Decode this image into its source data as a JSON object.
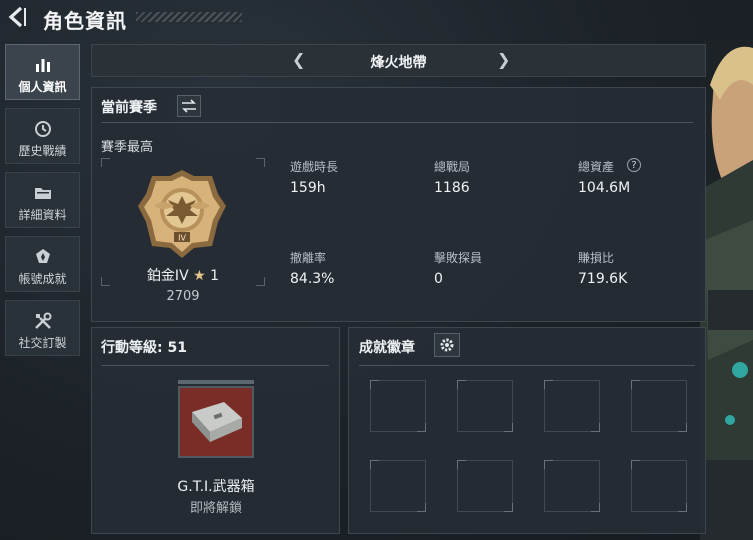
{
  "header": {
    "title": "角色資訊"
  },
  "sidebar": {
    "items": [
      {
        "label": "個人資訊",
        "icon": "bar-chart-icon",
        "active": true
      },
      {
        "label": "歷史戰績",
        "icon": "history-clock-icon",
        "active": false
      },
      {
        "label": "詳細資料",
        "icon": "folder-icon",
        "active": false
      },
      {
        "label": "帳號成就",
        "icon": "medal-icon",
        "active": false
      },
      {
        "label": "社交訂製",
        "icon": "tools-icon",
        "active": false
      }
    ]
  },
  "tabbar": {
    "title": "烽火地帶"
  },
  "season": {
    "title": "當前賽季",
    "subtitle": "賽季最高",
    "rank_name": "鉑金IV",
    "rank_stars": "1",
    "rank_score": "2709",
    "stats": [
      {
        "label": "遊戲時長",
        "value": "159h"
      },
      {
        "label": "總戰局",
        "value": "1186"
      },
      {
        "label": "總資產",
        "value": "104.6M"
      },
      {
        "label": "撤離率",
        "value": "84.3%"
      },
      {
        "label": "擊敗探員",
        "value": "0"
      },
      {
        "label": "賺損比",
        "value": "719.6K"
      }
    ],
    "help": "?"
  },
  "action_level": {
    "title": "行動等級: 51",
    "reward_name": "G.T.I.武器箱",
    "reward_status": "即將解鎖"
  },
  "badges": {
    "title": "成就徽章"
  },
  "colors": {
    "accent": "#c9a46a",
    "crate": "#7a2c26",
    "background": "#1b2127"
  }
}
